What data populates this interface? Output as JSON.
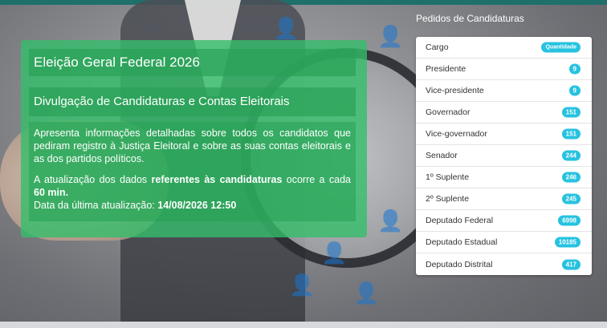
{
  "panel": {
    "title": "Eleição Geral Federal 2026",
    "subtitle": "Divulgação de Candidaturas e Contas Eleitorais",
    "description": "Apresenta informações detalhadas sobre todos os candidatos que pediram registro à Justiça Eleitoral e sobre as suas contas eleitorais e as dos partidos políticos.",
    "update_prefix": "A atualização dos dados ",
    "update_bold": "referentes às candidaturas",
    "update_mid": " ocorre a cada ",
    "update_interval": "60 min.",
    "last_update_label": "Data da última atualização: ",
    "last_update_value": "14/08/2026 12:50"
  },
  "candidacies": {
    "title": "Pedidos de Candidaturas",
    "header": {
      "label": "Cargo",
      "badge": "Quantidade"
    },
    "rows": [
      {
        "label": "Presidente",
        "count": "9"
      },
      {
        "label": "Vice-presidente",
        "count": "9"
      },
      {
        "label": "Governador",
        "count": "151"
      },
      {
        "label": "Vice-governador",
        "count": "151"
      },
      {
        "label": "Senador",
        "count": "244"
      },
      {
        "label": "1º Suplente",
        "count": "246"
      },
      {
        "label": "2º Suplente",
        "count": "245"
      },
      {
        "label": "Deputado Federal",
        "count": "6998"
      },
      {
        "label": "Deputado Estadual",
        "count": "10185"
      },
      {
        "label": "Deputado Distrital",
        "count": "417"
      }
    ]
  },
  "colors": {
    "panel_green": "#34be6a",
    "badge_blue": "#26c2e0",
    "top_bar": "#1f6f6b"
  }
}
